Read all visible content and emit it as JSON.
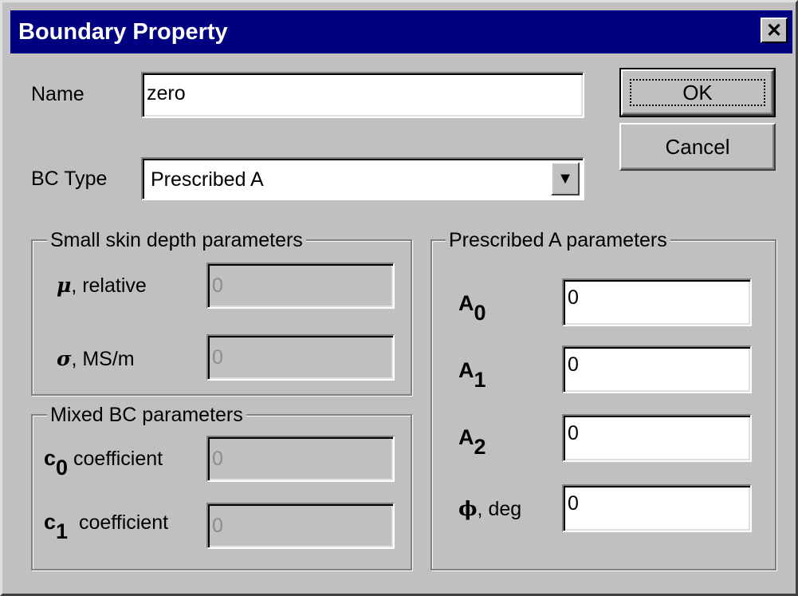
{
  "dialog": {
    "title": "Boundary Property",
    "close_label": "✕"
  },
  "name_field": {
    "label": "Name",
    "value": "zero"
  },
  "bc_type": {
    "label": "BC Type",
    "value": "Prescribed A",
    "arrow": "▼"
  },
  "buttons": {
    "ok": "OK",
    "cancel": "Cancel"
  },
  "skin_depth": {
    "legend": "Small skin depth parameters",
    "mu_symbol": "μ",
    "mu_label": ", relative",
    "mu_value": "0",
    "sigma_symbol": "σ",
    "sigma_label": ", MS/m",
    "sigma_value": "0"
  },
  "mixed": {
    "legend": "Mixed BC parameters",
    "c0_letter": "c",
    "c0_sub": "0",
    "c0_label": " coefficient",
    "c0_value": "0",
    "c1_letter": "c",
    "c1_sub": "1",
    "c1_label": "  coefficient",
    "c1_value": "0"
  },
  "prescribed": {
    "legend": "Prescribed A parameters",
    "a0_letter": "A",
    "a0_sub": "0",
    "a0_value": "0",
    "a1_letter": "A",
    "a1_sub": "1",
    "a1_value": "0",
    "a2_letter": "A",
    "a2_sub": "2",
    "a2_value": "0",
    "phi_symbol": "ϕ",
    "phi_label": ", deg",
    "phi_value": "0"
  }
}
